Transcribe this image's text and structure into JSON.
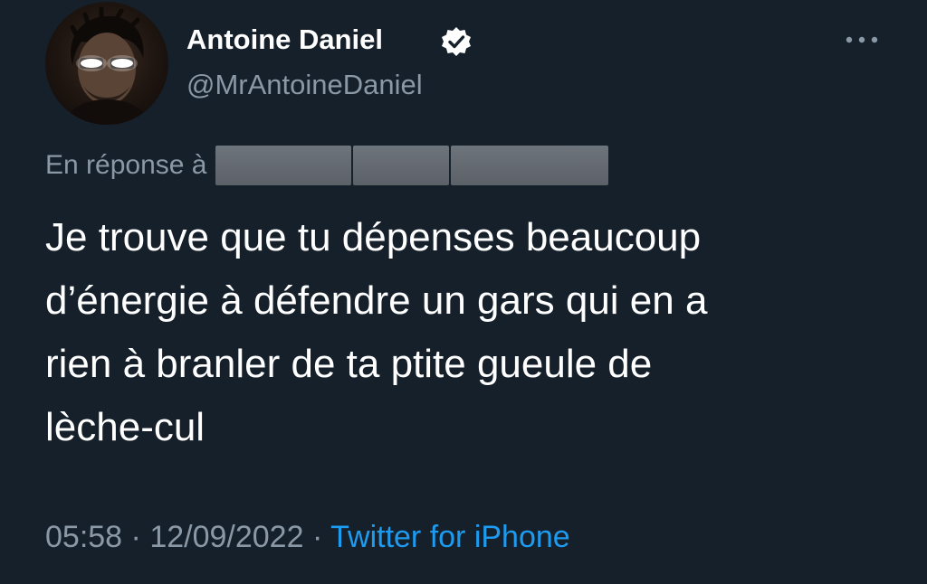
{
  "tweet": {
    "author": {
      "display_name": "Antoine Daniel",
      "handle": "@MrAntoineDaniel",
      "verified": true
    },
    "reply_label": "En réponse à",
    "text_lines": [
      "Je trouve que tu dépenses beaucoup",
      "d’énergie à défendre un gars qui en a",
      "rien à branler de ta ptite gueule de",
      "lèche-cul"
    ],
    "time": "05:58",
    "separator": "·",
    "date": "12/09/2022",
    "source": "Twitter for iPhone"
  },
  "colors": {
    "background": "#15202b",
    "primary_text": "#ffffff",
    "secondary_text": "#8b98a5",
    "link": "#1d9bf0"
  },
  "icons": {
    "verified": "verified-badge-icon",
    "more": "more-options-icon"
  }
}
